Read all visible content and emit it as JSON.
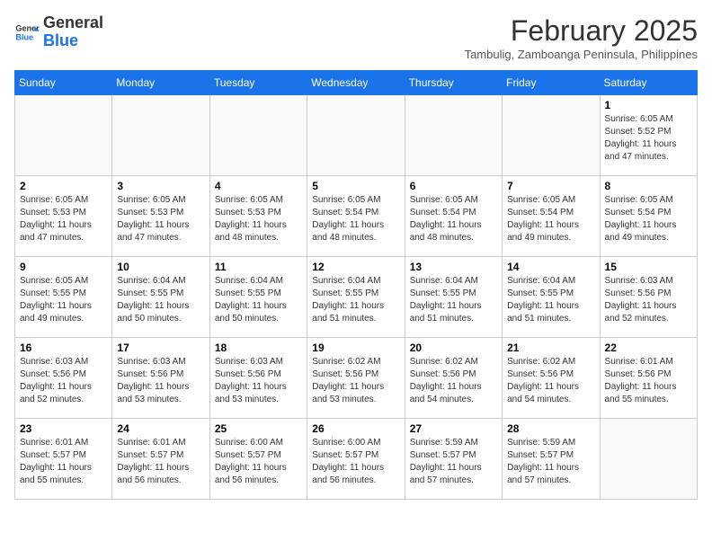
{
  "header": {
    "logo_line1": "General",
    "logo_line2": "Blue",
    "month": "February 2025",
    "location": "Tambulig, Zamboanga Peninsula, Philippines"
  },
  "days_of_week": [
    "Sunday",
    "Monday",
    "Tuesday",
    "Wednesday",
    "Thursday",
    "Friday",
    "Saturday"
  ],
  "weeks": [
    [
      {
        "day": "",
        "info": ""
      },
      {
        "day": "",
        "info": ""
      },
      {
        "day": "",
        "info": ""
      },
      {
        "day": "",
        "info": ""
      },
      {
        "day": "",
        "info": ""
      },
      {
        "day": "",
        "info": ""
      },
      {
        "day": "1",
        "info": "Sunrise: 6:05 AM\nSunset: 5:52 PM\nDaylight: 11 hours\nand 47 minutes."
      }
    ],
    [
      {
        "day": "2",
        "info": "Sunrise: 6:05 AM\nSunset: 5:53 PM\nDaylight: 11 hours\nand 47 minutes."
      },
      {
        "day": "3",
        "info": "Sunrise: 6:05 AM\nSunset: 5:53 PM\nDaylight: 11 hours\nand 47 minutes."
      },
      {
        "day": "4",
        "info": "Sunrise: 6:05 AM\nSunset: 5:53 PM\nDaylight: 11 hours\nand 48 minutes."
      },
      {
        "day": "5",
        "info": "Sunrise: 6:05 AM\nSunset: 5:54 PM\nDaylight: 11 hours\nand 48 minutes."
      },
      {
        "day": "6",
        "info": "Sunrise: 6:05 AM\nSunset: 5:54 PM\nDaylight: 11 hours\nand 48 minutes."
      },
      {
        "day": "7",
        "info": "Sunrise: 6:05 AM\nSunset: 5:54 PM\nDaylight: 11 hours\nand 49 minutes."
      },
      {
        "day": "8",
        "info": "Sunrise: 6:05 AM\nSunset: 5:54 PM\nDaylight: 11 hours\nand 49 minutes."
      }
    ],
    [
      {
        "day": "9",
        "info": "Sunrise: 6:05 AM\nSunset: 5:55 PM\nDaylight: 11 hours\nand 49 minutes."
      },
      {
        "day": "10",
        "info": "Sunrise: 6:04 AM\nSunset: 5:55 PM\nDaylight: 11 hours\nand 50 minutes."
      },
      {
        "day": "11",
        "info": "Sunrise: 6:04 AM\nSunset: 5:55 PM\nDaylight: 11 hours\nand 50 minutes."
      },
      {
        "day": "12",
        "info": "Sunrise: 6:04 AM\nSunset: 5:55 PM\nDaylight: 11 hours\nand 51 minutes."
      },
      {
        "day": "13",
        "info": "Sunrise: 6:04 AM\nSunset: 5:55 PM\nDaylight: 11 hours\nand 51 minutes."
      },
      {
        "day": "14",
        "info": "Sunrise: 6:04 AM\nSunset: 5:55 PM\nDaylight: 11 hours\nand 51 minutes."
      },
      {
        "day": "15",
        "info": "Sunrise: 6:03 AM\nSunset: 5:56 PM\nDaylight: 11 hours\nand 52 minutes."
      }
    ],
    [
      {
        "day": "16",
        "info": "Sunrise: 6:03 AM\nSunset: 5:56 PM\nDaylight: 11 hours\nand 52 minutes."
      },
      {
        "day": "17",
        "info": "Sunrise: 6:03 AM\nSunset: 5:56 PM\nDaylight: 11 hours\nand 53 minutes."
      },
      {
        "day": "18",
        "info": "Sunrise: 6:03 AM\nSunset: 5:56 PM\nDaylight: 11 hours\nand 53 minutes."
      },
      {
        "day": "19",
        "info": "Sunrise: 6:02 AM\nSunset: 5:56 PM\nDaylight: 11 hours\nand 53 minutes."
      },
      {
        "day": "20",
        "info": "Sunrise: 6:02 AM\nSunset: 5:56 PM\nDaylight: 11 hours\nand 54 minutes."
      },
      {
        "day": "21",
        "info": "Sunrise: 6:02 AM\nSunset: 5:56 PM\nDaylight: 11 hours\nand 54 minutes."
      },
      {
        "day": "22",
        "info": "Sunrise: 6:01 AM\nSunset: 5:56 PM\nDaylight: 11 hours\nand 55 minutes."
      }
    ],
    [
      {
        "day": "23",
        "info": "Sunrise: 6:01 AM\nSunset: 5:57 PM\nDaylight: 11 hours\nand 55 minutes."
      },
      {
        "day": "24",
        "info": "Sunrise: 6:01 AM\nSunset: 5:57 PM\nDaylight: 11 hours\nand 56 minutes."
      },
      {
        "day": "25",
        "info": "Sunrise: 6:00 AM\nSunset: 5:57 PM\nDaylight: 11 hours\nand 56 minutes."
      },
      {
        "day": "26",
        "info": "Sunrise: 6:00 AM\nSunset: 5:57 PM\nDaylight: 11 hours\nand 56 minutes."
      },
      {
        "day": "27",
        "info": "Sunrise: 5:59 AM\nSunset: 5:57 PM\nDaylight: 11 hours\nand 57 minutes."
      },
      {
        "day": "28",
        "info": "Sunrise: 5:59 AM\nSunset: 5:57 PM\nDaylight: 11 hours\nand 57 minutes."
      },
      {
        "day": "",
        "info": ""
      }
    ]
  ]
}
